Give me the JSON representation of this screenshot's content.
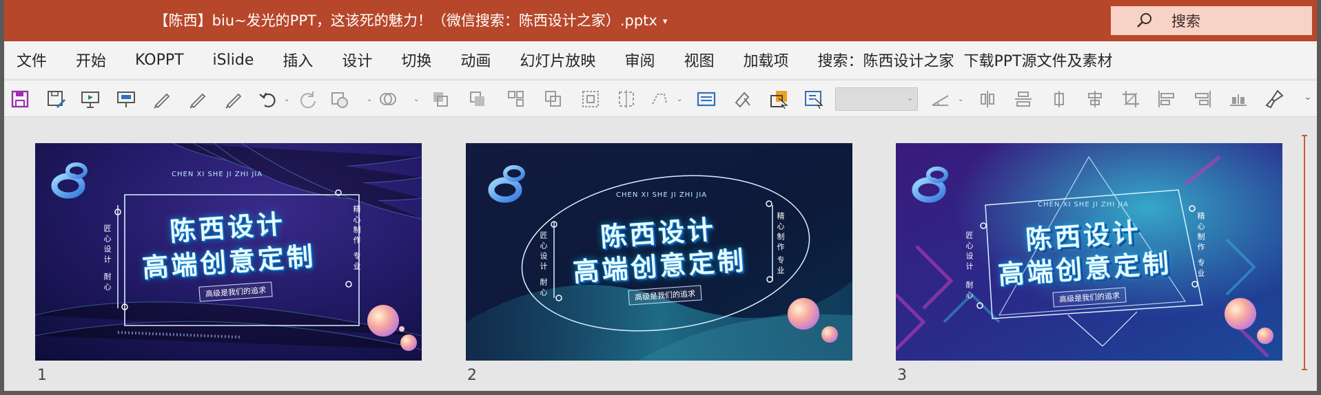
{
  "window": {
    "title": "【陈西】biu~发光的PPT，这该死的魅力！（微信搜索：陈西设计之家）.pptx",
    "title_caret": "▾",
    "search_label": "搜索",
    "accent": "#b7472a"
  },
  "menu": [
    "文件",
    "开始",
    "KOPPT",
    "iSlide",
    "插入",
    "设计",
    "切换",
    "动画",
    "幻灯片放映",
    "审阅",
    "视图",
    "加载项",
    "搜索：陈西设计之家",
    "下载PPT源文件及素材"
  ],
  "toolbar": {
    "icons": [
      "save-icon",
      "save-as-icon",
      "slideshow-from-start-icon",
      "slideshow-current-icon",
      "pen-icon",
      "pen-alt-icon",
      "pen-thin-icon",
      "undo-icon",
      "redo-icon",
      "shape-icon",
      "merge-shapes-icon",
      "bring-forward-icon",
      "send-backward-icon",
      "group-icon",
      "ungroup-icon",
      "select-objects-icon",
      "align-box-icon",
      "crop-shape-icon",
      "text-box-icon",
      "format-painter-icon",
      "selection-pane-icon",
      "edit-text-icon",
      "line-icon",
      "align-center-icon",
      "align-middle-icon",
      "distribute-icon",
      "align-bottom-icon",
      "crop-icon",
      "align-left-icon",
      "align-right-icon",
      "distribute-vertical-icon",
      "brush-icon",
      "more-icon"
    ],
    "font_combo_value": ""
  },
  "slides": [
    {
      "number": "1",
      "subtitle": "CHEN XI SHE JI ZHI JIA",
      "line1": "陈西设计",
      "line2": "高端创意定制",
      "tagline": "高级是我们的追求",
      "left_vertical": "匠心设计",
      "left_vertical2": "耐心",
      "right_vertical": "精心制作",
      "right_vertical2": "专业"
    },
    {
      "number": "2",
      "subtitle": "CHEN XI SHE JI ZHI JIA",
      "line1": "陈西设计",
      "line2": "高端创意定制",
      "tagline": "高级是我们的追求",
      "left_vertical": "匠心设计",
      "left_vertical2": "耐心",
      "right_vertical": "精心制作",
      "right_vertical2": "专业"
    },
    {
      "number": "3",
      "subtitle": "CHEN XI SHE JI ZHI JIA",
      "line1": "陈西设计",
      "line2": "高端创意定制",
      "tagline": "高级是我们的追求",
      "left_vertical": "匠心设计",
      "left_vertical2": "耐心",
      "right_vertical": "精心制作",
      "right_vertical2": "专业"
    }
  ]
}
